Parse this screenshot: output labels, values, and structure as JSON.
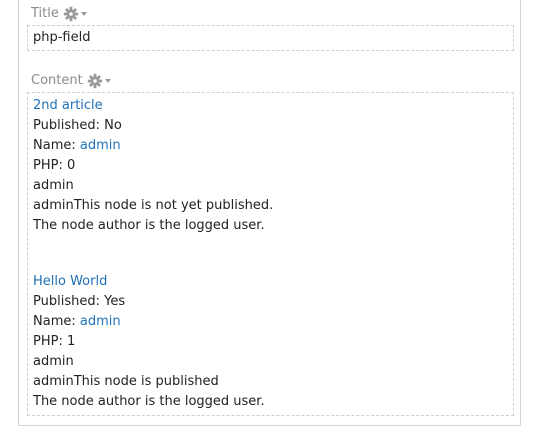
{
  "title_section": {
    "label": "Title",
    "value": "php-field"
  },
  "content_section": {
    "label": "Content",
    "articles": [
      {
        "title": "2nd article",
        "published_label": "Published: No",
        "name_prefix": "Name: ",
        "name_link": "admin",
        "php_label": "PHP: 0",
        "author_line": "admin",
        "status_line": "adminThis node is not yet published.",
        "note_line": "The node author is the logged user."
      },
      {
        "title": "Hello World",
        "published_label": "Published: Yes",
        "name_prefix": "Name: ",
        "name_link": "admin",
        "php_label": "PHP: 1",
        "author_line": "admin",
        "status_line": "adminThis node is published",
        "note_line": "The node author is the logged user."
      }
    ]
  },
  "colors": {
    "link": "#1f71b8",
    "label_gray": "#8a8a8a",
    "border": "#d4d4d4"
  },
  "icons": {
    "settings": "gear-icon",
    "dropdown": "triangle-down-icon"
  }
}
